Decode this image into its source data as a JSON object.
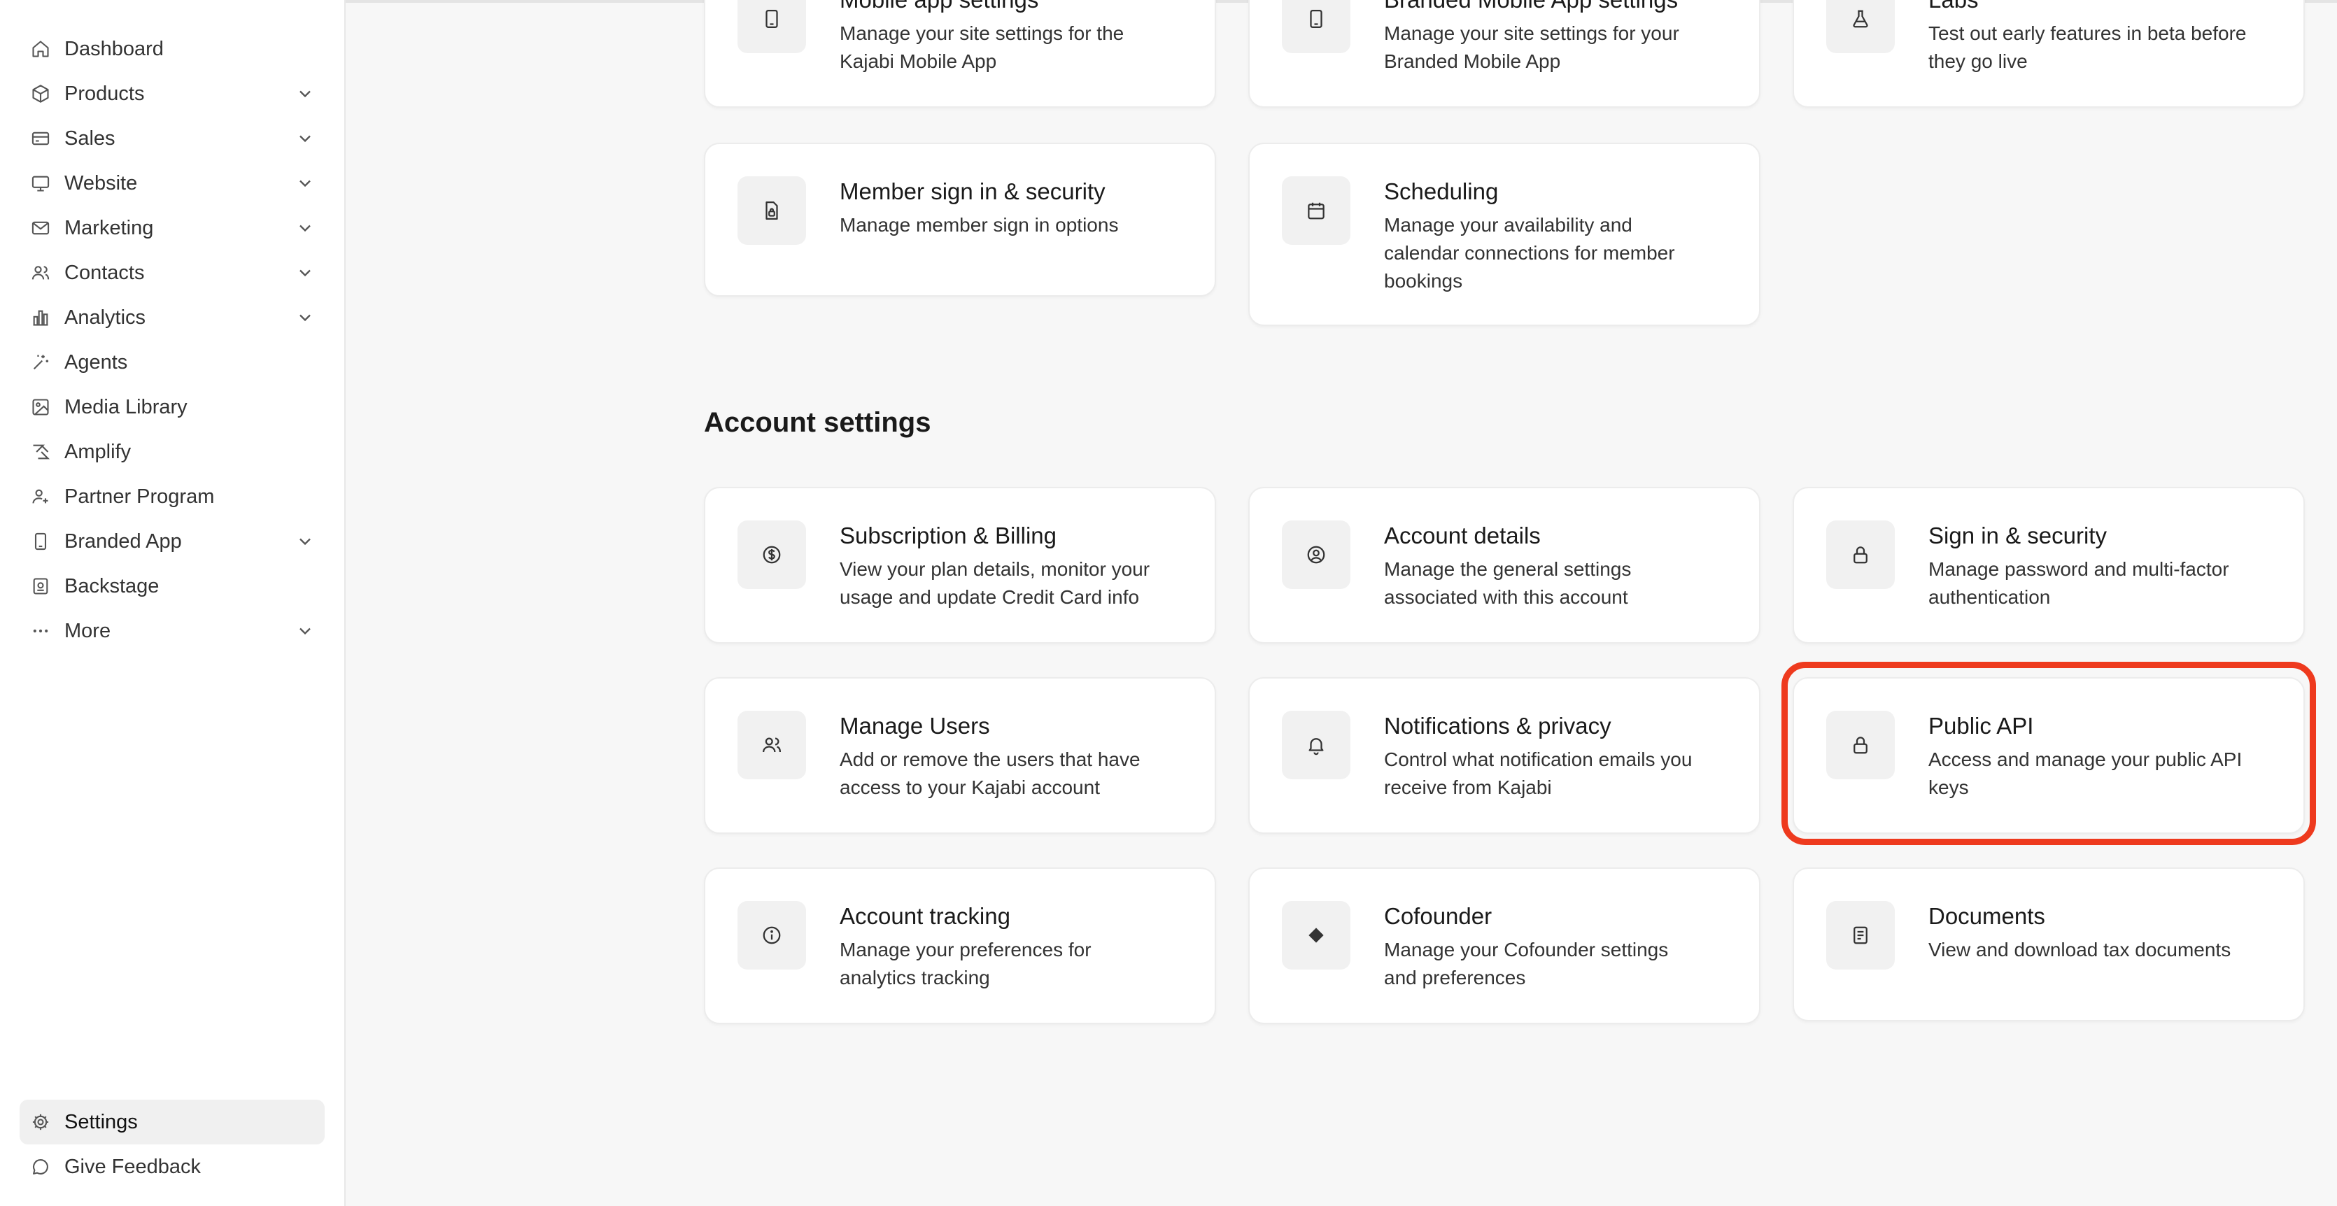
{
  "sidebar": {
    "items": [
      {
        "label": "Dashboard",
        "icon": "home-icon",
        "expandable": false
      },
      {
        "label": "Products",
        "icon": "box-icon",
        "expandable": true
      },
      {
        "label": "Sales",
        "icon": "credit-card-icon",
        "expandable": true
      },
      {
        "label": "Website",
        "icon": "monitor-icon",
        "expandable": true
      },
      {
        "label": "Marketing",
        "icon": "mail-icon",
        "expandable": true
      },
      {
        "label": "Contacts",
        "icon": "users-icon",
        "expandable": true
      },
      {
        "label": "Analytics",
        "icon": "bar-chart-icon",
        "expandable": true
      },
      {
        "label": "Agents",
        "icon": "sparkle-icon",
        "expandable": false
      },
      {
        "label": "Media Library",
        "icon": "image-icon",
        "expandable": false
      },
      {
        "label": "Amplify",
        "icon": "amplify-icon",
        "expandable": false
      },
      {
        "label": "Partner Program",
        "icon": "user-plus-icon",
        "expandable": false
      },
      {
        "label": "Branded App",
        "icon": "phone-icon",
        "expandable": true
      },
      {
        "label": "Backstage",
        "icon": "backstage-icon",
        "expandable": false
      },
      {
        "label": "More",
        "icon": "ellipsis-icon",
        "expandable": true
      }
    ],
    "bottom": [
      {
        "label": "Settings",
        "icon": "gear-icon",
        "active": true
      },
      {
        "label": "Give Feedback",
        "icon": "chat-bubble-icon",
        "active": false
      }
    ]
  },
  "site_settings": {
    "cards": [
      {
        "title": "Mobile app settings",
        "desc": [
          "Manage your site settings for the",
          "Kajabi Mobile App"
        ],
        "icon": "phone-icon"
      },
      {
        "title": "Branded Mobile App settings",
        "desc": [
          "Manage your site settings for your",
          "Branded Mobile App"
        ],
        "icon": "phone-icon"
      },
      {
        "title": "Labs",
        "desc": [
          "Test out early features in beta before",
          "they go live"
        ],
        "icon": "flask-icon"
      },
      {
        "title": "Member sign in & security",
        "desc": [
          "Manage member sign in options"
        ],
        "icon": "file-lock-icon"
      },
      {
        "title": "Scheduling",
        "desc": [
          "Manage your availability and",
          "calendar connections for member",
          "bookings"
        ],
        "icon": "calendar-icon"
      }
    ]
  },
  "account_settings": {
    "heading": "Account settings",
    "cards": [
      {
        "title": "Subscription & Billing",
        "desc": [
          "View your plan details, monitor your",
          "usage and update Credit Card info"
        ],
        "icon": "dollar-circle-icon"
      },
      {
        "title": "Account details",
        "desc": [
          "Manage the general settings",
          "associated with this account"
        ],
        "icon": "user-circle-icon"
      },
      {
        "title": "Sign in & security",
        "desc": [
          "Manage password and multi-factor",
          "authentication"
        ],
        "icon": "lock-icon"
      },
      {
        "title": "Manage Users",
        "desc": [
          "Add or remove the users that have",
          "access to your Kajabi account"
        ],
        "icon": "users-icon"
      },
      {
        "title": "Notifications & privacy",
        "desc": [
          "Control what notification emails you",
          "receive from Kajabi"
        ],
        "icon": "bell-icon"
      },
      {
        "title": "Public API",
        "desc": [
          "Access and manage your public API",
          "keys"
        ],
        "icon": "lock-icon"
      },
      {
        "title": "Account tracking",
        "desc": [
          "Manage your preferences for",
          "analytics tracking"
        ],
        "icon": "info-circle-icon"
      },
      {
        "title": "Cofounder",
        "desc": [
          "Manage your Cofounder settings",
          "and preferences"
        ],
        "icon": "diamond-icon"
      },
      {
        "title": "Documents",
        "desc": [
          "View and download tax documents"
        ],
        "icon": "document-icon"
      }
    ]
  },
  "colors": {
    "highlight": "#ee3a1e",
    "card_bg": "#ffffff",
    "page_bg": "#f7f7f7",
    "tile_bg": "#f1f1f1"
  }
}
